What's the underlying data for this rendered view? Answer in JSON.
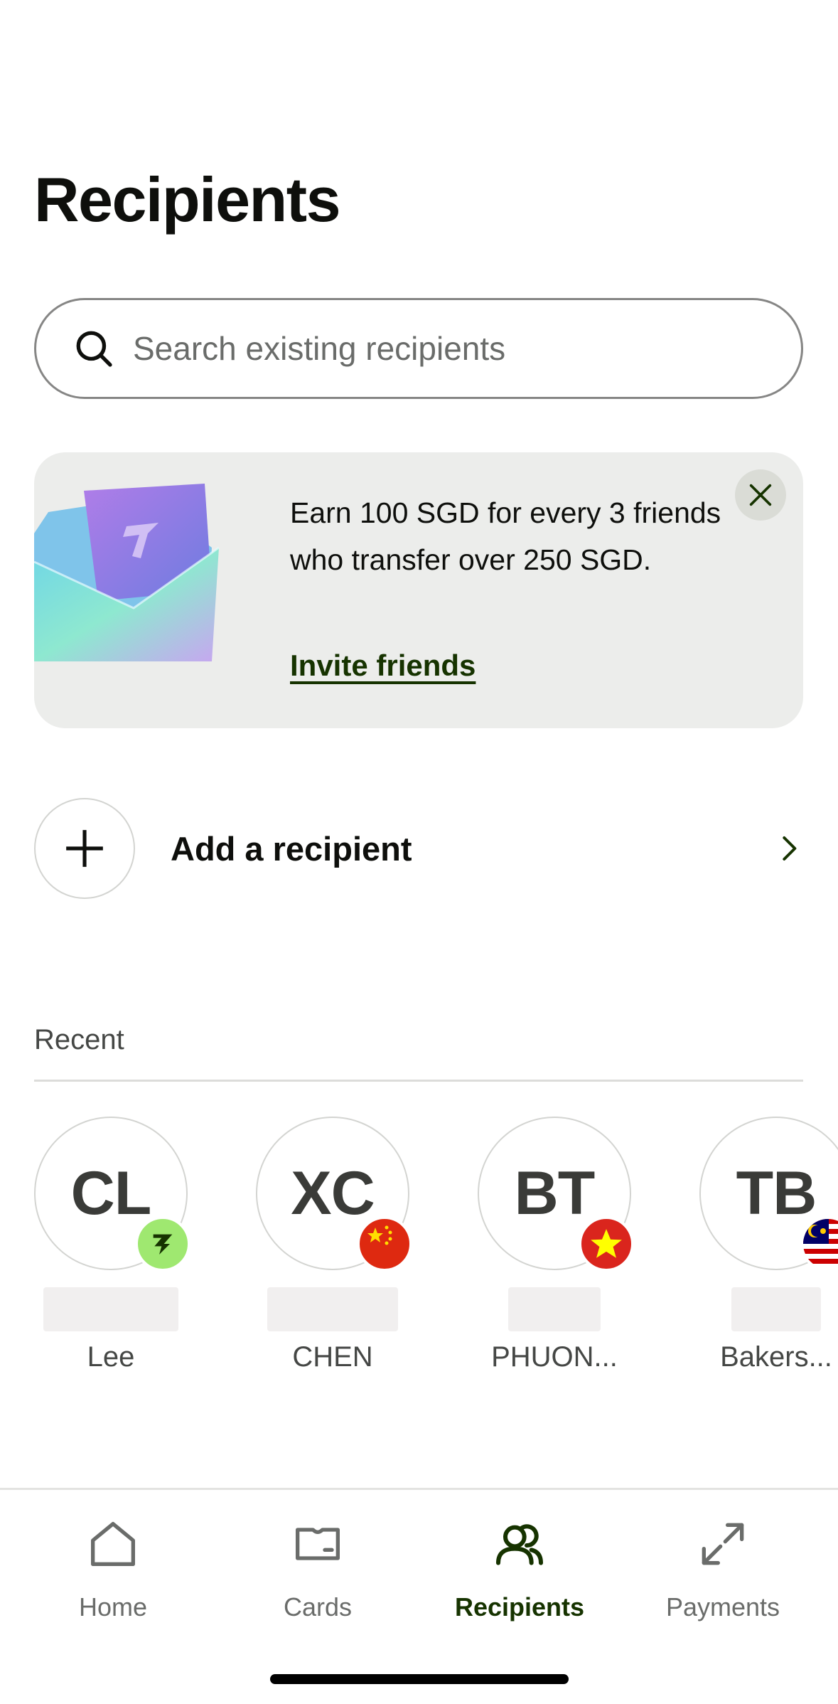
{
  "header": {
    "title": "Recipients"
  },
  "search": {
    "placeholder": "Search existing recipients"
  },
  "promo": {
    "text": "Earn 100 SGD for every 3 friends who transfer over 250 SGD.",
    "link_label": "Invite friends",
    "close_icon": "close-icon"
  },
  "add_recipient": {
    "label": "Add a recipient",
    "icon": "plus-icon",
    "chevron": "chevron-right-icon"
  },
  "recent": {
    "label": "Recent",
    "items": [
      {
        "initials": "CL",
        "name": "Lee",
        "badge": "wise-logo-badge"
      },
      {
        "initials": "XC",
        "name": "CHEN",
        "badge": "china-flag-badge"
      },
      {
        "initials": "BT",
        "name": "PHUON...",
        "badge": "vietnam-flag-badge"
      },
      {
        "initials": "TB",
        "name": "Bakers...",
        "badge": "malaysia-flag-badge"
      }
    ]
  },
  "tabs": [
    {
      "label": "Home",
      "icon": "home-icon",
      "active": false
    },
    {
      "label": "Cards",
      "icon": "card-icon",
      "active": false
    },
    {
      "label": "Recipients",
      "icon": "recipients-icon",
      "active": true
    },
    {
      "label": "Payments",
      "icon": "payments-icon",
      "active": false
    }
  ],
  "colors": {
    "brand_dark_green": "#163300",
    "brand_bright_green": "#9fe870",
    "promo_background": "#ecedeb",
    "china_red": "#de2910",
    "vietnam_red": "#da251d",
    "star_yellow": "#ffff00"
  }
}
